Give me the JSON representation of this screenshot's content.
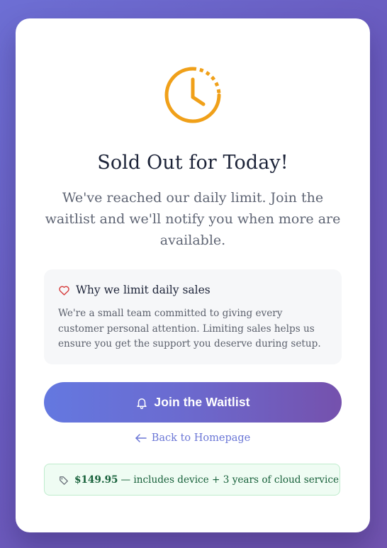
{
  "title": "Sold Out for Today!",
  "subtitle": "We've reached our daily limit. Join the waitlist and we'll notify you when more are available.",
  "info": {
    "icon": "heart-icon",
    "title": "Why we limit daily sales",
    "text": "We're a small team committed to giving every customer personal attention. Limiting sales helps us ensure you get the support you deserve during setup."
  },
  "waitlist_button": {
    "icon": "bell-icon",
    "label": "Join the Waitlist"
  },
  "back_link": {
    "icon": "arrow-left-icon",
    "label": "Back to Homepage"
  },
  "price": {
    "icon": "tag-icon",
    "amount": "$149.95",
    "description": "— includes device + 3 years of cloud service"
  },
  "colors": {
    "accent_clock": "#f0a019",
    "heading": "#1c2338",
    "link": "#6a76d6",
    "price_green": "#17603a",
    "heart_red": "#d63b3b"
  }
}
